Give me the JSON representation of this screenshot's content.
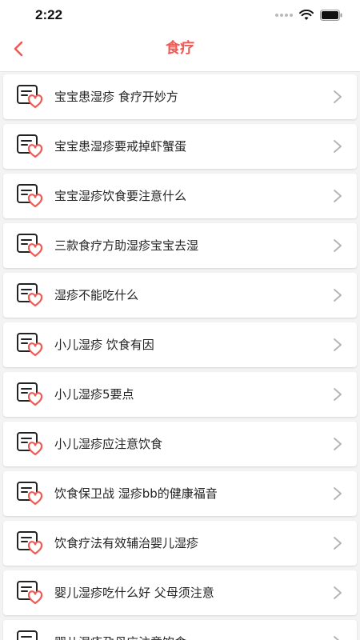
{
  "status_bar": {
    "time": "2:22"
  },
  "nav": {
    "title": "食疗",
    "back_icon": "chevron-left-icon"
  },
  "colors": {
    "accent": "#f05a55",
    "text": "#222222",
    "chevron": "#b5b5b5"
  },
  "list": {
    "item_icon": "recipe-heart-icon",
    "items": [
      {
        "label": "宝宝患湿疹 食疗开妙方"
      },
      {
        "label": "宝宝患湿疹要戒掉虾蟹蛋"
      },
      {
        "label": "宝宝湿疹饮食要注意什么"
      },
      {
        "label": "三款食疗方助湿疹宝宝去湿"
      },
      {
        "label": "湿疹不能吃什么"
      },
      {
        "label": "小儿湿疹 饮食有因"
      },
      {
        "label": "小儿湿疹5要点"
      },
      {
        "label": "小儿湿疹应注意饮食"
      },
      {
        "label": "饮食保卫战 湿疹bb的健康福音"
      },
      {
        "label": "饮食疗法有效辅治婴儿湿疹"
      },
      {
        "label": "婴儿湿疹吃什么好 父母须注意"
      },
      {
        "label": "婴儿湿疹孕母应注意饮食"
      }
    ]
  }
}
